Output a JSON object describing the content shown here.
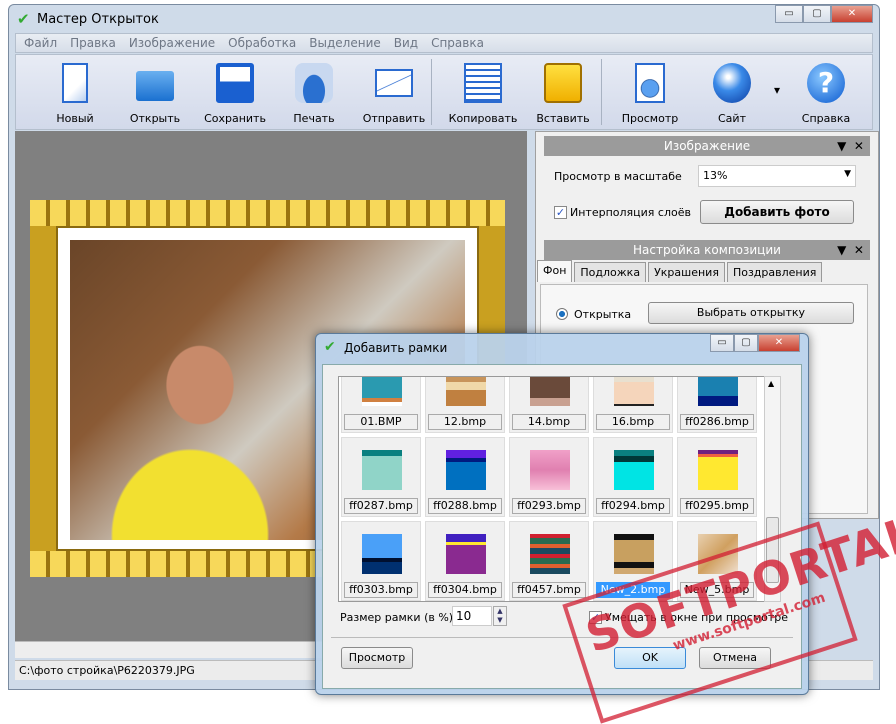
{
  "window": {
    "title": "Мастер Открыток",
    "controls": [
      "▭",
      "▢",
      "✕"
    ]
  },
  "menu": [
    "Файл",
    "Правка",
    "Изображение",
    "Обработка",
    "Выделение",
    "Вид",
    "Справка"
  ],
  "toolbar": [
    {
      "label": "Новый",
      "icon": "new-document-icon"
    },
    {
      "label": "Открыть",
      "icon": "open-folder-icon"
    },
    {
      "label": "Сохранить",
      "icon": "floppy-disk-icon"
    },
    {
      "label": "Печать",
      "icon": "printer-icon"
    },
    {
      "label": "Отправить",
      "icon": "envelope-icon"
    },
    {
      "label": "Копировать",
      "icon": "copy-icon"
    },
    {
      "label": "Вставить",
      "icon": "paste-icon"
    },
    {
      "label": "Просмотр",
      "icon": "preview-magnifier-icon"
    },
    {
      "label": "Сайт",
      "icon": "globe-icon"
    },
    {
      "label": "Справка",
      "icon": "help-icon"
    }
  ],
  "status": "C:\\фото стройка\\P6220379.JPG",
  "image_panel": {
    "title": "Изображение",
    "zoom_label": "Просмотр в масштабе",
    "zoom_value": "13%",
    "interp_label": "Интерполяция слоёв",
    "interp_checked": true,
    "add_photo": "Добавить фото"
  },
  "comp_panel": {
    "title": "Настройка композиции",
    "tabs": [
      "Фон",
      "Подложка",
      "Украшения",
      "Поздравления"
    ],
    "active_tab": "Фон",
    "radio_label": "Открытка",
    "choose_button": "Выбрать открытку"
  },
  "dialog": {
    "title": "Добавить рамки",
    "size_label": "Размер рамки (в %)",
    "size_value": "10",
    "fit_label": "Умещать в окне при просмотре",
    "fit_checked": true,
    "preview": "Просмотр",
    "ok": "OK",
    "cancel": "Отмена",
    "selected": "New_2.bmp",
    "items": [
      {
        "name": "01.BMP",
        "thumb": "linear-gradient(#2a9ab0 0 80%,#d08040 80% 90%,#fff 90%)"
      },
      {
        "name": "12.bmp",
        "thumb": "linear-gradient(#c8945a 0 40%,#f0d8a8 40% 60%,#c08040 60%)"
      },
      {
        "name": "14.bmp",
        "thumb": "linear-gradient(#6a4a3a 0 80%,#c8a090 80%)"
      },
      {
        "name": "16.bmp",
        "thumb": "linear-gradient(#e8e0d0 0 40%,#f5d5bb 40% 95%,#222 95%)"
      },
      {
        "name": "ff0286.bmp",
        "thumb": "linear-gradient(#1a80b0 0 75%,#001a80 75%)"
      },
      {
        "name": "ff0287.bmp",
        "thumb": "linear-gradient(#0a8080 0 15%,#90d4c8 15%)"
      },
      {
        "name": "ff0288.bmp",
        "thumb": "linear-gradient(#6020e0 0 20%,#001a80 20% 30%,#0070c0 30%)"
      },
      {
        "name": "ff0293.bmp",
        "thumb": "linear-gradient(#f0a0c8,#e080b0,#f8c0d8)"
      },
      {
        "name": "ff0294.bmp",
        "thumb": "linear-gradient(#0a8080 0 15%,#003838 15% 30%,#00e4e4 30%)"
      },
      {
        "name": "ff0295.bmp",
        "thumb": "linear-gradient(#702080 0 10%,#f06040 10% 18%,#ffe830 18%)"
      },
      {
        "name": "ff0303.bmp",
        "thumb": "linear-gradient(#4aa0f8 0 60%,#001030 60% 70%,#003070 70%)"
      },
      {
        "name": "ff0304.bmp",
        "thumb": "linear-gradient(#4020c0 0 20%,#ffe830 20% 28%,#8a2a90 28%)"
      },
      {
        "name": "ff0457.bmp",
        "thumb": "repeating-linear-gradient(#d02030 0 10%,#2a6a50 10% 25%,#e06030 25% 35%,#1a4a60 35% 50%)"
      },
      {
        "name": "New_2.bmp",
        "thumb": "linear-gradient(#111 0 15%,#c8a060 15% 70%,#111 70% 85%,#d0a870 85%)"
      },
      {
        "name": "New_5.bmp",
        "thumb": "linear-gradient(135deg,#e8d0b0,#d0a060,#f0e0d0)"
      }
    ]
  },
  "watermark": {
    "text": "SOFTPORTAL",
    "url": "www.softportal.com",
    "color": "#d21e32"
  }
}
